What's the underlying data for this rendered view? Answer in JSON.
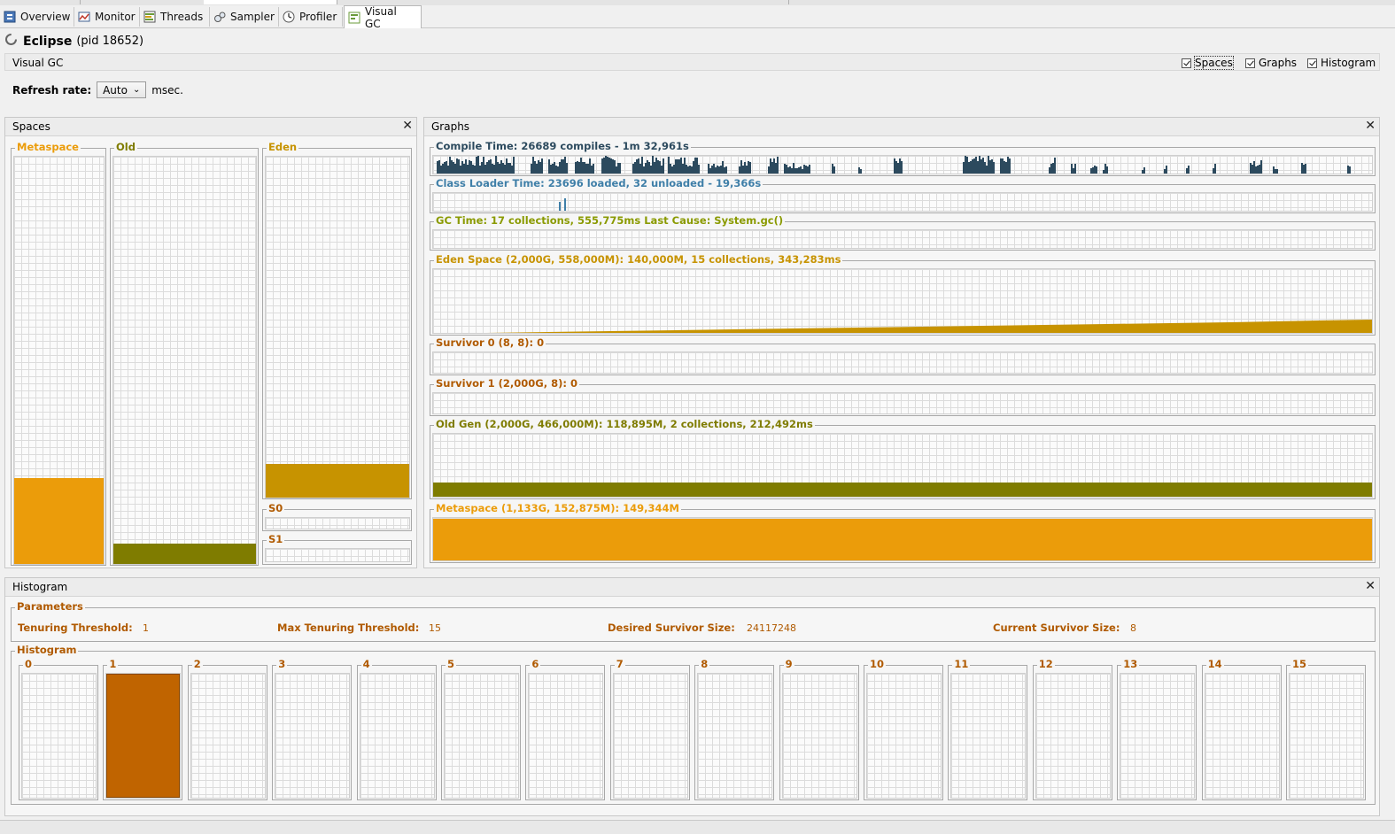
{
  "tabs": [
    {
      "label": "Overview",
      "icon": "overview-icon"
    },
    {
      "label": "Monitor",
      "icon": "monitor-icon"
    },
    {
      "label": "Threads",
      "icon": "threads-icon"
    },
    {
      "label": "Sampler",
      "icon": "sampler-icon"
    },
    {
      "label": "Profiler",
      "icon": "profiler-icon"
    },
    {
      "label": "Visual GC",
      "icon": "visual-gc-icon"
    }
  ],
  "app": {
    "name": "Eclipse",
    "pid": "(pid 18652)"
  },
  "visual_gc": {
    "label": "Visual GC",
    "checkboxes": [
      "Spaces",
      "Graphs",
      "Histogram"
    ]
  },
  "refresh": {
    "label": "Refresh rate:",
    "value": "Auto",
    "unit": "msec."
  },
  "colors": {
    "metaspace": "#eb9c0a",
    "old": "#7f7c00",
    "eden": "#c79300",
    "compile": "#2c4a5e",
    "classloader": "#3f7fa8",
    "gctime": "#8a9a00",
    "survivor": "#b05a00",
    "histogram": "#c06400"
  },
  "spaces": {
    "title": "Spaces",
    "columns": [
      {
        "label": "Metaspace",
        "fill": 0.21
      },
      {
        "label": "Old",
        "fill": 0.05
      },
      {
        "label": "Eden",
        "fill": 0.1
      }
    ],
    "survivors": [
      {
        "label": "S0"
      },
      {
        "label": "S1"
      }
    ]
  },
  "graphs": {
    "title": "Graphs",
    "rows": [
      {
        "label": "Compile Time: 26689 compiles - 1m 32,961s"
      },
      {
        "label": "Class Loader Time: 23696 loaded, 32 unloaded - 19,366s"
      },
      {
        "label": "GC Time: 17 collections, 555,775ms Last Cause: System.gc()"
      },
      {
        "label": "Eden Space (2,000G, 558,000M): 140,000M, 15 collections, 343,283ms"
      },
      {
        "label": "Survivor 0 (8, 8): 0"
      },
      {
        "label": "Survivor 1 (2,000G, 8): 0"
      },
      {
        "label": "Old Gen (2,000G, 466,000M): 118,895M, 2 collections, 212,492ms"
      },
      {
        "label": "Metaspace (1,133G, 152,875M): 149,344M"
      }
    ]
  },
  "histogram": {
    "title": "Histogram",
    "parameters_title": "Parameters",
    "params": [
      {
        "label": "Tenuring Threshold:",
        "value": "1"
      },
      {
        "label": "Max Tenuring Threshold:",
        "value": "15"
      },
      {
        "label": "Desired Survivor Size:",
        "value": "24117248"
      },
      {
        "label": "Current Survivor Size:",
        "value": "8"
      }
    ],
    "section_title": "Histogram",
    "bins": [
      "0",
      "1",
      "2",
      "3",
      "4",
      "5",
      "6",
      "7",
      "8",
      "9",
      "10",
      "11",
      "12",
      "13",
      "14",
      "15"
    ],
    "bin_fill": [
      0,
      1,
      0,
      0,
      0,
      0,
      0,
      0,
      0,
      0,
      0,
      0,
      0,
      0,
      0,
      0
    ]
  }
}
